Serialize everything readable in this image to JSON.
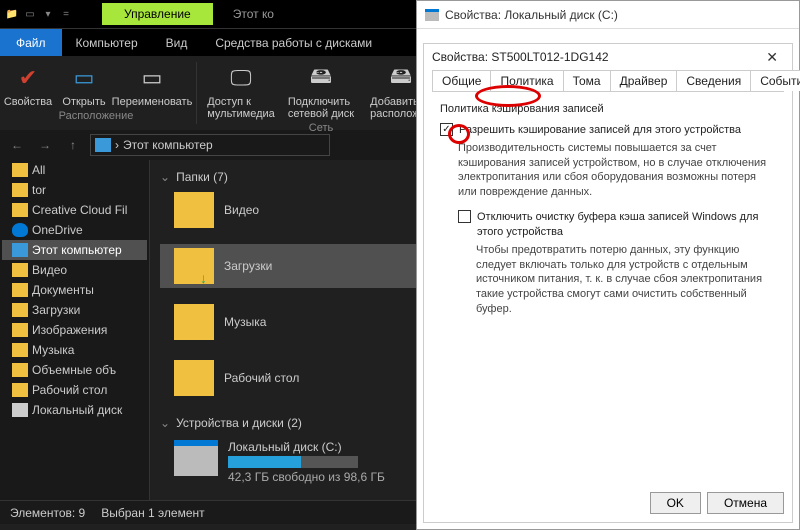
{
  "titlebar": {
    "title": "Этот кo",
    "mgmt_tab": "Управление"
  },
  "winbtns": {
    "min": "—",
    "max": "☐",
    "close": "✕"
  },
  "menubar": {
    "file": "Файл",
    "computer": "Компьютер",
    "view": "Вид",
    "disk_tools": "Средства работы с дисками"
  },
  "ribbon": {
    "props": "Свойства",
    "open": "Открыть",
    "rename": "Переименовать",
    "media": "Доступ к\nмультимедиа",
    "netdrive": "Подключить\nсетевой диск",
    "addloc": "Добавить\nрасположен",
    "grp_location": "Расположение",
    "grp_network": "Сеть"
  },
  "addrbar": {
    "path_label": "Этот компьютер"
  },
  "tree": {
    "items": [
      {
        "label": "All",
        "icon": "ic-folder"
      },
      {
        "label": "tor",
        "icon": "ic-folder"
      },
      {
        "label": "Creative Cloud Fil",
        "icon": "ic-folder"
      },
      {
        "label": "OneDrive",
        "icon": "ic-cloud"
      },
      {
        "label": "Этот компьютер",
        "icon": "ic-pc",
        "selected": true
      },
      {
        "label": "Видео",
        "icon": "ic-folder"
      },
      {
        "label": "Документы",
        "icon": "ic-folder"
      },
      {
        "label": "Загрузки",
        "icon": "ic-folder"
      },
      {
        "label": "Изображения",
        "icon": "ic-folder"
      },
      {
        "label": "Музыка",
        "icon": "ic-folder"
      },
      {
        "label": "Объемные объ",
        "icon": "ic-folder"
      },
      {
        "label": "Рабочий стол",
        "icon": "ic-folder"
      },
      {
        "label": "Локальный диск",
        "icon": "ic-drive"
      }
    ]
  },
  "content": {
    "folders_header": "Папки (7)",
    "folders": [
      {
        "label": "Видео"
      },
      {
        "label": "Загрузки",
        "selected": true
      },
      {
        "label": "Музыка"
      },
      {
        "label": "Рабочий стол"
      }
    ],
    "devices_header": "Устройства и диски (2)",
    "drive": {
      "label": "Локальный диск (C:)",
      "free": "42,3 ГБ свободно из 98,6 ГБ"
    }
  },
  "status": {
    "items": "Элементов: 9",
    "selected": "Выбран 1 элемент"
  },
  "dlg": {
    "outer_title": "Свойства: Локальный диск (C:)",
    "inner_title": "Свойства: ST500LT012-1DG142",
    "tabs": [
      "Общие",
      "Политика",
      "Тома",
      "Драйвер",
      "Сведения",
      "События"
    ],
    "active_tab": 1,
    "group_label": "Политика кэширования записей",
    "chk1_label": "Разрешить кэширование записей для этого устройства",
    "chk1_desc": "Производительность системы повышается за счет кэширования записей устройством, но в случае отключения электропитания или сбоя оборудования возможны потеря или повреждение данных.",
    "chk2_label": "Отключить очистку буфера кэша записей Windows для этого устройства",
    "chk2_desc": "Чтобы предотвратить потерю данных, эту функцию следует включать только для устройств с отдельным источником питания, т. к. в случае сбоя электропитания такие устройства смогут сами очистить собственный буфер.",
    "ok": "OK",
    "cancel": "Отмена"
  }
}
